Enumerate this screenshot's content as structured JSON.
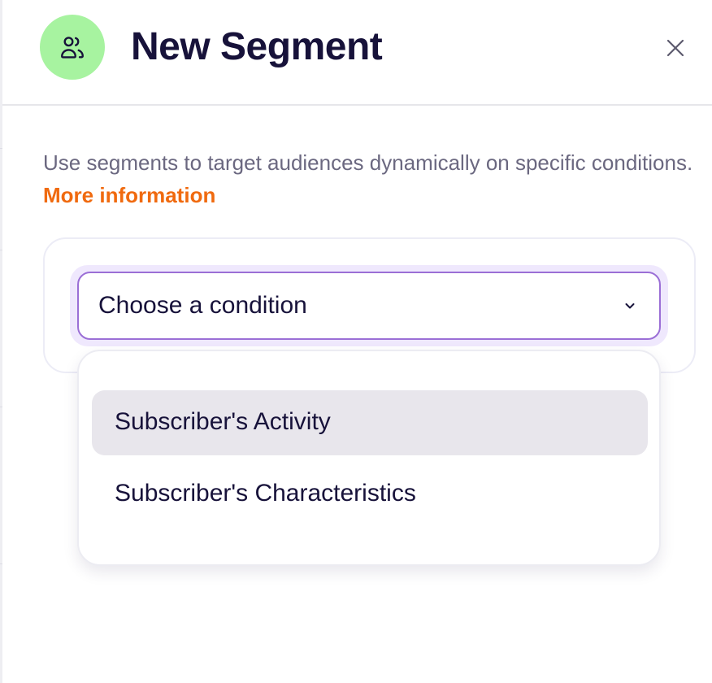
{
  "header": {
    "title": "New Segment",
    "icon": "users-icon",
    "icon_bg_color": "#a7f3a0",
    "close_icon": "close-icon"
  },
  "description": {
    "text": "Use segments to target audiences dynamically on specific conditions. ",
    "link_text": "More information",
    "link_color": "#f06a0f"
  },
  "condition_select": {
    "placeholder": "Choose a condition",
    "icon": "chevron-down-icon",
    "focus_color": "#9b6fd6"
  },
  "dropdown": {
    "options": [
      {
        "label": "Subscriber's Activity",
        "highlighted": true
      },
      {
        "label": "Subscriber's Characteristics",
        "highlighted": false
      }
    ]
  }
}
